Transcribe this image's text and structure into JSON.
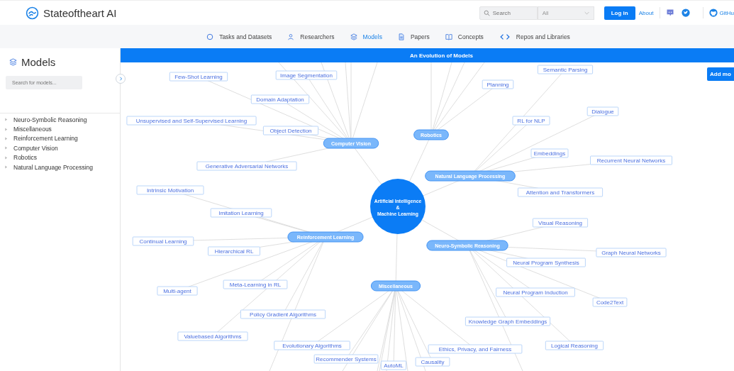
{
  "brand": {
    "name": "Stateoftheart AI"
  },
  "search": {
    "placeholder": "Search",
    "scope": "All"
  },
  "header_links": {
    "login": "Log in",
    "about": "About",
    "github": "GitHu"
  },
  "nav": [
    {
      "label": "Tasks and Datasets",
      "selected": false
    },
    {
      "label": "Researchers",
      "selected": false
    },
    {
      "label": "Models",
      "selected": true
    },
    {
      "label": "Papers",
      "selected": false
    },
    {
      "label": "Concepts",
      "selected": false
    },
    {
      "label": "Repos and Libraries",
      "selected": false
    }
  ],
  "sidebar": {
    "title": "Models",
    "search_placeholder": "Search for models...",
    "items": [
      {
        "label": "Neuro-Symbolic Reasoning",
        "expanded": false
      },
      {
        "label": "Miscellaneous",
        "expanded": false
      },
      {
        "label": "Reinforcement Learning",
        "expanded": false
      },
      {
        "label": "Computer Vision",
        "expanded": false
      },
      {
        "label": "Robotics",
        "expanded": false
      },
      {
        "label": "Natural Language Processing",
        "expanded": false
      }
    ]
  },
  "graph": {
    "title": "An Evolution of Models",
    "add_button": "Add mo",
    "root": [
      "Artificial Intelligence",
      "&",
      "Machine Learning"
    ],
    "categories": [
      {
        "label": "Computer Vision",
        "children": [
          "Few-Shot Learning",
          "Image Segmentation",
          "Domain Adaptation",
          "Unsupervised and Self-Supervised Learning",
          "Object Detection",
          "Generative Adversarial Networks"
        ]
      },
      {
        "label": "Robotics",
        "children": [
          "Planning"
        ]
      },
      {
        "label": "Natural Language Processing",
        "children": [
          "Semantic Parsing",
          "RL for NLP",
          "Dialogue",
          "Embeddings",
          "Recurrent Neural Networks",
          "Attention and Transformers"
        ]
      },
      {
        "label": "Reinforcement Learning",
        "children": [
          "Intrinsic Motivation",
          "Imitation Learning",
          "Continual Learning",
          "Hierarchical RL",
          "Multi-agent",
          "Meta-Learning in RL",
          "Policy Gradient Algorithms",
          "Valuebased Algorithms"
        ]
      },
      {
        "label": "Neuro-Symbolic Reasoning",
        "children": [
          "Visual Reasoning",
          "Graph Neural Networks",
          "Neural Program Synthesis",
          "Neural Program Induction",
          "Code2Text",
          "Knowledge Graph Embeddings",
          "Logical Reasoning"
        ]
      },
      {
        "label": "Miscellaneous",
        "children": [
          "Evolutionary Algorithms",
          "Recommender Systems",
          "AutoML",
          "Causality",
          "Ethics, Privacy, and Fairness"
        ]
      }
    ]
  }
}
